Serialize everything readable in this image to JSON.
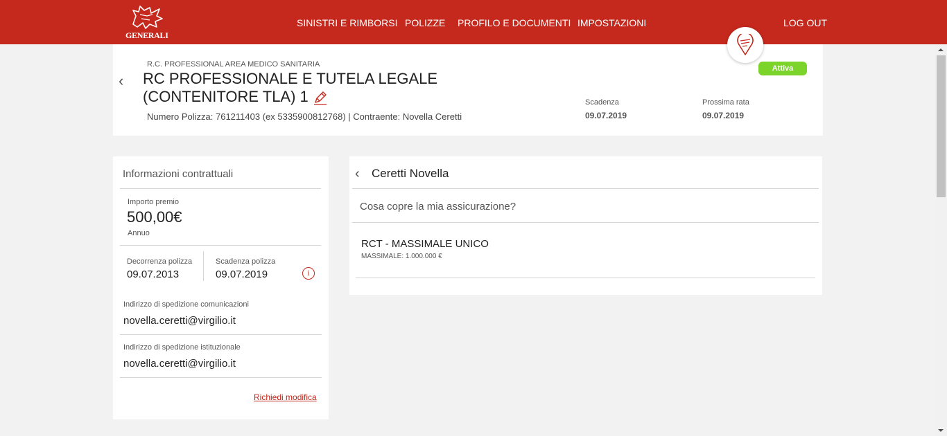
{
  "header": {
    "logo_text": "GENERALI",
    "nav": [
      "SINISTRI E RIMBORSI",
      "POLIZZE",
      "PROFILO E DOCUMENTI",
      "IMPOSTAZIONI"
    ],
    "logout": "LOG OUT",
    "brand_color": "#c5281c"
  },
  "policy": {
    "category": "R.C. PROFESSIONAL AREA MEDICO SANITARIA",
    "title_line1": "RC PROFESSIONALE E TUTELA LEGALE",
    "title_line2": "(CONTENITORE TLA) 1",
    "meta": "Numero Polizza: 761211403 (ex 5335900812768) | Contraente: Novella Ceretti",
    "scadenza_label": "Scadenza",
    "scadenza_value": "09.07.2019",
    "rata_label": "Prossima rata",
    "rata_value": "09.07.2019",
    "status": "Attiva",
    "status_color": "#7cd42b"
  },
  "info": {
    "title": "Informazioni contrattuali",
    "premio_label": "Importo premio",
    "premio_value": "500,00€",
    "premio_freq": "Annuo",
    "decorrenza_label": "Decorrenza polizza",
    "decorrenza_value": "09.07.2013",
    "scadenza_label": "Scadenza polizza",
    "scadenza_value": "09.07.2019",
    "com_label": "Indirizzo di spedizione comunicazioni",
    "com_value": "novella.ceretti@virgilio.it",
    "ist_label": "Indirizzo di spedizione istituzionale",
    "ist_value": "novella.ceretti@virgilio.it",
    "modifica_link": "Richiedi modifica"
  },
  "coverage": {
    "title": "Ceretti Novella",
    "question": "Cosa copre la mia assicurazione?",
    "item_title": "RCT - MASSIMALE UNICO",
    "item_sub": "MASSIMALE: 1.000.000 €"
  },
  "icons": [
    "generali-lion-icon",
    "chevron-left-icon",
    "pencil-icon",
    "location-pin-icon",
    "info-icon"
  ]
}
